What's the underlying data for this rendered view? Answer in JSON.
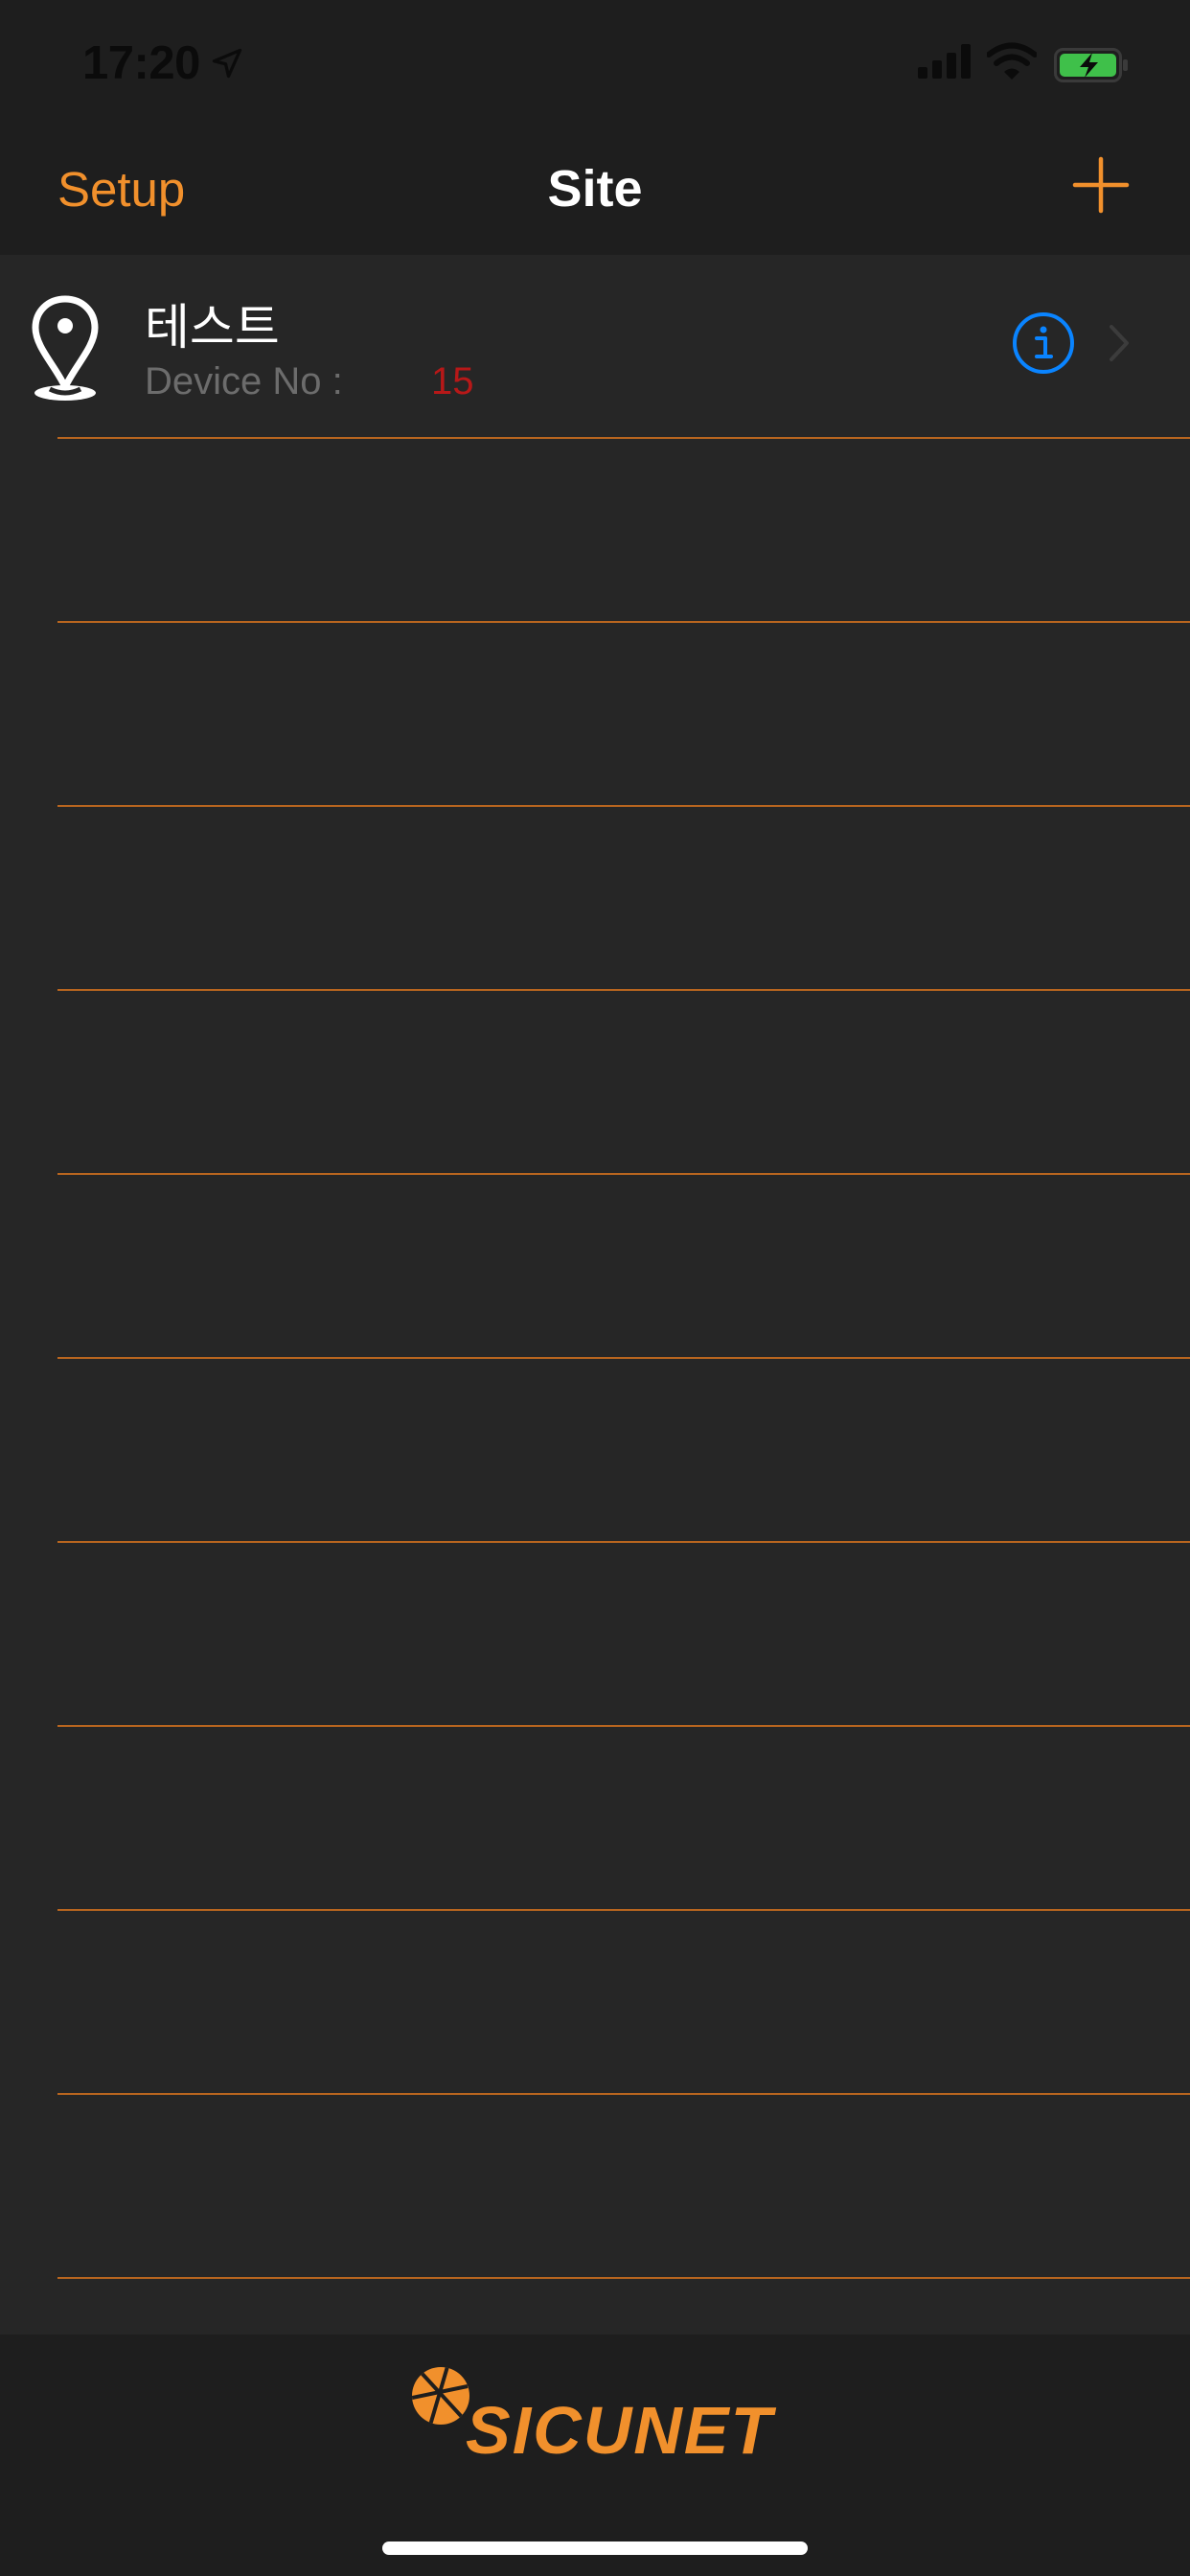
{
  "status_bar": {
    "time": "17:20",
    "icons": [
      "location-arrow-icon",
      "cellular-signal-icon",
      "wifi-icon",
      "battery-charging-icon"
    ],
    "battery_color": "#3fc04a"
  },
  "nav": {
    "left_label": "Setup",
    "title": "Site",
    "right_icon": "plus-icon",
    "accent_color": "#f1902c"
  },
  "sites": [
    {
      "name": "테스트",
      "device_label": "Device No :",
      "device_count": "15",
      "icons": [
        "map-pin-icon",
        "info-icon",
        "chevron-right-icon"
      ]
    }
  ],
  "empty_rows": 10,
  "footer": {
    "brand": "SICUNET"
  },
  "colors": {
    "background": "#1e1e1e",
    "list_background": "#262626",
    "separator": "#b8651f",
    "info": "#0a84ff",
    "device_count": "#b71818"
  }
}
